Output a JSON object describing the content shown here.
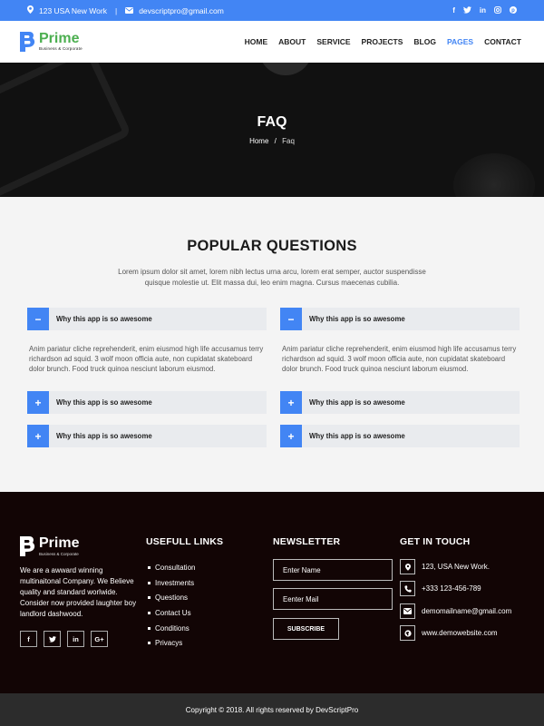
{
  "topbar": {
    "address": "123 USA New Work",
    "email": "devscriptpro@gmail.com",
    "social_icons": [
      "facebook-icon",
      "twitter-icon",
      "linkedin-icon",
      "instagram-icon",
      "pinterest-icon"
    ],
    "bg_color": "#4285f4"
  },
  "logo": {
    "name": "Prime",
    "tagline": "Business & Corporate"
  },
  "nav": {
    "items": [
      "HOME",
      "ABOUT",
      "SERVICE",
      "PROJECTS",
      "BLOG",
      "PAGES",
      "CONTACT"
    ],
    "active": "PAGES"
  },
  "hero": {
    "title": "FAQ",
    "breadcrumb_home": "Home",
    "breadcrumb_sep": "/",
    "breadcrumb_current": "Faq"
  },
  "faq": {
    "title": "POPULAR QUESTIONS",
    "description": "Lorem ipsum dolor sit amet, lorem nibh lectus urna arcu, lorem erat semper, auctor suspendisse quisque molestie ut. Elit massa dui, leo enim magna. Cursus maecenas cubilia.",
    "left": [
      {
        "question": "Why this app is so awesome",
        "expanded": true,
        "icon": "−",
        "answer": "Anim pariatur cliche reprehenderit, enim eiusmod high life accusamus terry richardson ad squid. 3 wolf moon officia aute, non cupidatat skateboard dolor brunch. Food truck quinoa nesciunt laborum eiusmod."
      },
      {
        "question": "Why this app is so awesome",
        "expanded": false,
        "icon": "+"
      },
      {
        "question": "Why this app is so awesome",
        "expanded": false,
        "icon": "+"
      }
    ],
    "right": [
      {
        "question": "Why this app is so awesome",
        "expanded": true,
        "icon": "−",
        "answer": "Anim pariatur cliche reprehenderit, enim eiusmod high life accusamus terry richardson ad squid. 3 wolf moon officia aute, non cupidatat skateboard dolor brunch. Food truck quinoa nesciunt laborum eiusmod."
      },
      {
        "question": "Why this app is so awesome",
        "expanded": false,
        "icon": "+"
      },
      {
        "question": "Why this app is so awesome",
        "expanded": false,
        "icon": "+"
      }
    ]
  },
  "footer": {
    "about": "We are a awward winning multinaitonal Company. We Believe quality and standard worlwide. Consider now provided laughter boy landlord dashwood.",
    "social": [
      "f",
      "t",
      "in",
      "G+"
    ],
    "links_title": "USEFULL LINKS",
    "links": [
      "Consultation",
      "Investments",
      "Questions",
      "Contact Us",
      "Conditions",
      "Privacys"
    ],
    "newsletter_title": "NEWSLETTER",
    "name_placeholder": "Enter Name",
    "mail_placeholder": "Eenter Mail",
    "subscribe": "SUBSCRIBE",
    "contact_title": "GET IN TOUCH",
    "contact": [
      {
        "icon": "map-marker-icon",
        "text": "123, USA New Work."
      },
      {
        "icon": "phone-icon",
        "text": "+333 123-456-789"
      },
      {
        "icon": "envelope-icon",
        "text": "demomailname@gmail.com"
      },
      {
        "icon": "globe-icon",
        "text": "www.demowebsite.com"
      }
    ]
  },
  "copyright": "Copyright © 2018. All rights reserved by DevScriptPro"
}
